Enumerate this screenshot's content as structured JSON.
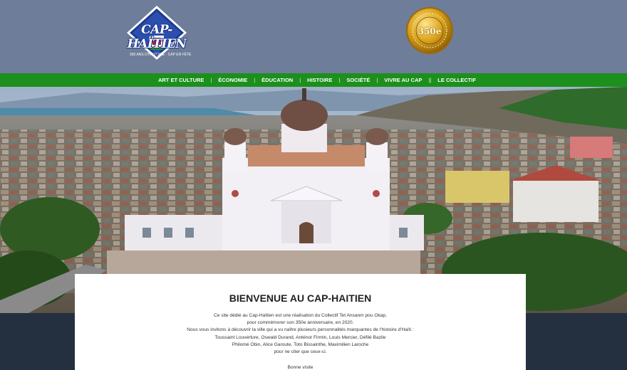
{
  "header": {
    "logo": {
      "title": "CAP-HAÏTIEN",
      "tagline": "350 ANS D'HISTOIRE · CAP EN FÊTE"
    },
    "medal": {
      "text": "350e"
    },
    "background_color": "#6e7d99"
  },
  "nav": {
    "background_color": "#1c8f1c",
    "items": [
      {
        "label": "ART ET CULTURE",
        "sep": "|"
      },
      {
        "label": "ÉCONOMIE",
        "sep": "|"
      },
      {
        "label": "ÉDUCATION",
        "sep": "|"
      },
      {
        "label": "HISTOIRE",
        "sep": "|"
      },
      {
        "label": "SOCIÉTÉ",
        "sep": "|"
      },
      {
        "label": "VIVRE AU CAP",
        "sep": "||"
      },
      {
        "label": "LE COLLECTIF",
        "sep": ""
      }
    ]
  },
  "hero": {
    "image_subject": "aerial-view-cathedral-cap-haitien"
  },
  "welcome": {
    "title": "BIENVENUE AU CAP-HAITIEN",
    "paragraph_lines": [
      "Ce site dédié au Cap-Haïtien est une réalisation du Collectif Tet Ansanm pou Okap,",
      "pour commémorer son 350e anniversaire, en 2020.",
      "Nous vous invitons à découvrir la ville qui a vu naître plusieurs personnalités marquantes de l'histoire d'Haïti :",
      "Toussaint Louverture, Oswald Durand, Anténor Firmin, Louis Mercier, Défilé Bazile",
      "Philomé Obin, Alice Garoute, Toto Bissainthe, Maximilien Laroche",
      "pour ne citer que ceux-ci."
    ],
    "closing": "Bonne visite"
  }
}
